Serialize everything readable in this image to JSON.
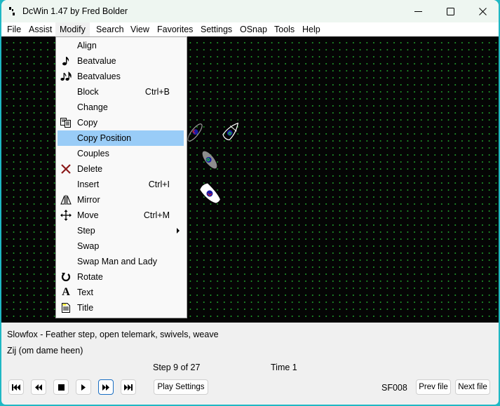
{
  "window": {
    "title": "DcWin 1.47 by Fred Bolder",
    "controls": {
      "minimize": "minimize-icon",
      "maximize": "maximize-icon",
      "close": "close-icon"
    }
  },
  "menubar": {
    "items": [
      {
        "label": "File"
      },
      {
        "label": "Assist"
      },
      {
        "label": "Modify",
        "active": true
      },
      {
        "label": "Search"
      },
      {
        "label": "View"
      },
      {
        "label": "Favorites"
      },
      {
        "label": "Settings"
      },
      {
        "label": "OSnap"
      },
      {
        "label": "Tools"
      },
      {
        "label": "Help"
      }
    ]
  },
  "modify_menu": {
    "items": [
      {
        "label": "Align",
        "icon": "",
        "shortcut": ""
      },
      {
        "label": "Beatvalue",
        "icon": "eighth-note-icon",
        "shortcut": ""
      },
      {
        "label": "Beatvalues",
        "icon": "beamed-notes-icon",
        "shortcut": ""
      },
      {
        "label": "Block",
        "icon": "",
        "shortcut": "Ctrl+B"
      },
      {
        "label": "Change",
        "icon": "",
        "shortcut": ""
      },
      {
        "label": "Copy",
        "icon": "copy-icon",
        "shortcut": ""
      },
      {
        "label": "Copy Position",
        "icon": "",
        "shortcut": "",
        "highlighted": true
      },
      {
        "label": "Couples",
        "icon": "",
        "shortcut": ""
      },
      {
        "label": "Delete",
        "icon": "delete-x-icon",
        "shortcut": ""
      },
      {
        "label": "Insert",
        "icon": "",
        "shortcut": "Ctrl+I"
      },
      {
        "label": "Mirror",
        "icon": "mirror-icon",
        "shortcut": ""
      },
      {
        "label": "Move",
        "icon": "move-arrows-icon",
        "shortcut": "Ctrl+M"
      },
      {
        "label": "Step",
        "icon": "",
        "shortcut": "",
        "submenu": true
      },
      {
        "label": "Swap",
        "icon": "",
        "shortcut": ""
      },
      {
        "label": "Swap Man and Lady",
        "icon": "",
        "shortcut": ""
      },
      {
        "label": "Rotate",
        "icon": "rotate-icon",
        "shortcut": ""
      },
      {
        "label": "Text",
        "icon": "text-a-icon",
        "shortcut": ""
      },
      {
        "label": "Title",
        "icon": "title-doc-icon",
        "shortcut": ""
      }
    ]
  },
  "canvas": {
    "background": "#050505",
    "grid_color": "#1f9a2a",
    "footprints": [
      {
        "name": "footprint-outline-gray",
        "style": "outline-gray"
      },
      {
        "name": "footprint-outline-white",
        "style": "outline-white"
      },
      {
        "name": "footprint-filled-gray",
        "style": "filled-gray"
      },
      {
        "name": "footprint-filled-white",
        "style": "filled-white"
      }
    ]
  },
  "status": {
    "dance_title": "Slowfox - Feather step, open telemark, swivels, weave",
    "step_description": "Zij (om dame heen)",
    "step_counter": "Step 9 of 27",
    "time_label": "Time 1",
    "file_code": "SF008"
  },
  "playback": {
    "buttons": [
      {
        "name": "first-step-button",
        "icon": "skip-to-start-icon"
      },
      {
        "name": "step-back-button",
        "icon": "rewind-icon"
      },
      {
        "name": "stop-button",
        "icon": "stop-icon"
      },
      {
        "name": "play-button",
        "icon": "play-icon"
      },
      {
        "name": "step-forward-button",
        "icon": "fast-forward-icon",
        "focused": true
      },
      {
        "name": "last-step-button",
        "icon": "skip-to-end-icon"
      }
    ],
    "play_settings_label": "Play Settings",
    "prev_file_label": "Prev file",
    "next_file_label": "Next file"
  },
  "colors": {
    "menu_highlight": "#99ccf7",
    "window_border": "#1fb8c4",
    "focus_border": "#1a6fc4",
    "delete_icon": "#8b1a1a"
  }
}
